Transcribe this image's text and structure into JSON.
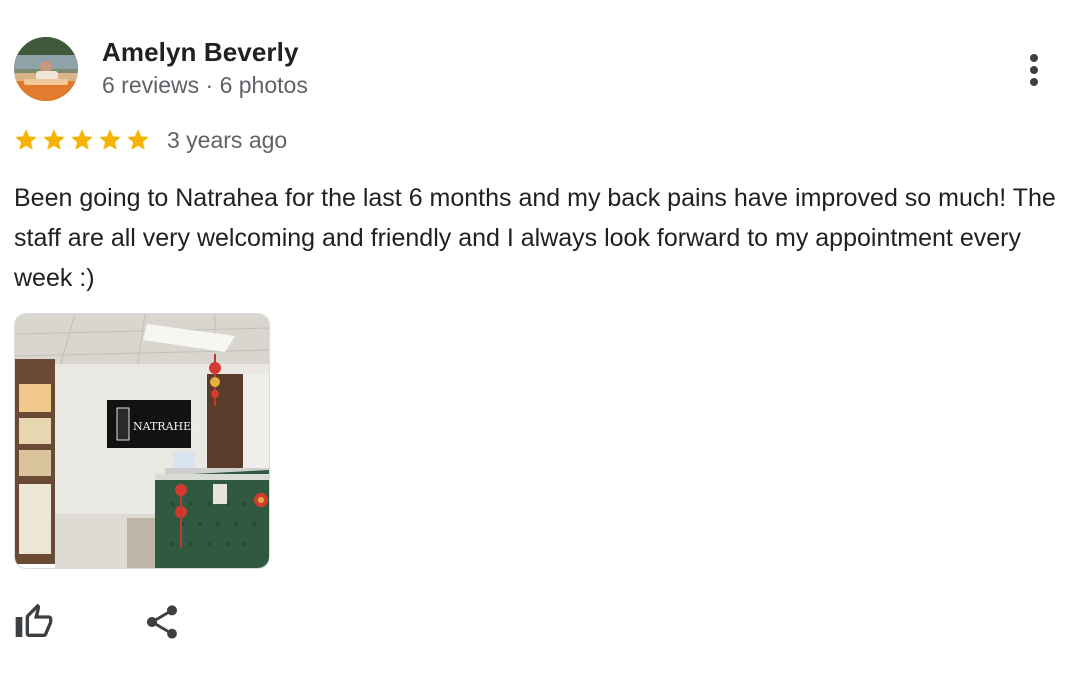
{
  "review": {
    "author": {
      "name": "Amelyn Beverly",
      "meta": "6 reviews · 6 photos"
    },
    "rating": 5,
    "date": "3 years ago",
    "text": "Been going to Natrahea for the last 6 months and my back pains have improved so much! The staff are all very welcoming and friendly and I always look forward to my appointment every week :)",
    "photo": {
      "sign_text": "NATRAHEA"
    },
    "icons": {
      "more": "more-vert-icon",
      "like": "thumb-up-icon",
      "share": "share-icon",
      "star": "star-icon"
    },
    "colors": {
      "star": "#f4b400",
      "text": "#202124",
      "secondary_text": "#5f6368",
      "icon": "#3c4043"
    }
  }
}
